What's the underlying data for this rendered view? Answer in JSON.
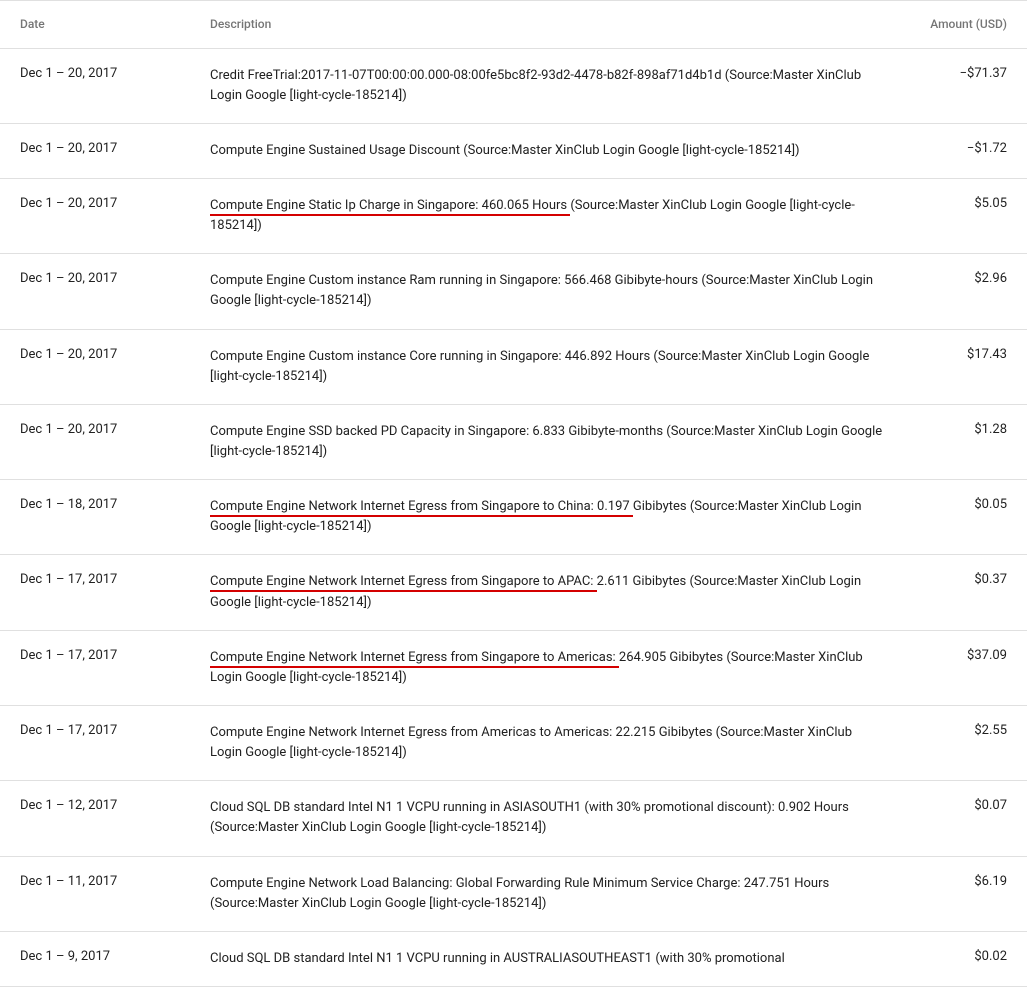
{
  "headers": {
    "date": "Date",
    "description": "Description",
    "amount": "Amount (USD)"
  },
  "rows": [
    {
      "date": "Dec 1 – 20, 2017",
      "desc_pre": "",
      "desc_hl": "",
      "desc_post": "Credit FreeTrial:2017-11-07T00:00:00.000-08:00fe5bc8f2-93d2-4478-b82f-898af71d4b1d (Source:Master XinClub Login Google [light-cycle-185214])",
      "amount": "−$71.37"
    },
    {
      "date": "Dec 1 – 20, 2017",
      "desc_pre": "",
      "desc_hl": "",
      "desc_post": "Compute Engine Sustained Usage Discount (Source:Master XinClub Login Google [light-cycle-185214])",
      "amount": "−$1.72"
    },
    {
      "date": "Dec 1 – 20, 2017",
      "desc_pre": "",
      "desc_hl": "Compute Engine Static Ip Charge in Singapore: 460.065 Hours ",
      "desc_post": "(Source:Master XinClub Login Google [light-cycle-185214])",
      "amount": "$5.05"
    },
    {
      "date": "Dec 1 – 20, 2017",
      "desc_pre": "",
      "desc_hl": "",
      "desc_post": "Compute Engine Custom instance Ram running in Singapore: 566.468 Gibibyte-hours (Source:Master XinClub Login Google [light-cycle-185214])",
      "amount": "$2.96"
    },
    {
      "date": "Dec 1 – 20, 2017",
      "desc_pre": "",
      "desc_hl": "",
      "desc_post": "Compute Engine Custom instance Core running in Singapore: 446.892 Hours (Source:Master XinClub Login Google [light-cycle-185214])",
      "amount": "$17.43"
    },
    {
      "date": "Dec 1 – 20, 2017",
      "desc_pre": "",
      "desc_hl": "",
      "desc_post": "Compute Engine SSD backed PD Capacity in Singapore: 6.833 Gibibyte-months (Source:Master XinClub Login Google [light-cycle-185214])",
      "amount": "$1.28"
    },
    {
      "date": "Dec 1 – 18, 2017",
      "desc_pre": "",
      "desc_hl": "Compute Engine Network Internet Egress from Singapore to China: 0.197 ",
      "desc_post": "Gibibytes (Source:Master XinClub Login Google [light-cycle-185214])",
      "amount": "$0.05"
    },
    {
      "date": "Dec 1 – 17, 2017",
      "desc_pre": "",
      "desc_hl": "Compute Engine Network Internet Egress from Singapore to APAC: ",
      "desc_post": "2.611 Gibibytes (Source:Master XinClub Login Google [light-cycle-185214])",
      "amount": "$0.37"
    },
    {
      "date": "Dec 1 – 17, 2017",
      "desc_pre": "",
      "desc_hl": "Compute Engine Network Internet Egress from Singapore to Americas: ",
      "desc_post": "264.905 Gibibytes (Source:Master XinClub Login Google [light-cycle-185214])",
      "amount": "$37.09"
    },
    {
      "date": "Dec 1 – 17, 2017",
      "desc_pre": "",
      "desc_hl": "",
      "desc_post": "Compute Engine Network Internet Egress from Americas to Americas: 22.215 Gibibytes (Source:Master XinClub Login Google [light-cycle-185214])",
      "amount": "$2.55"
    },
    {
      "date": "Dec 1 – 12, 2017",
      "desc_pre": "",
      "desc_hl": "",
      "desc_post": "Cloud SQL DB standard Intel N1 1 VCPU running in ASIASOUTH1 (with 30% promotional discount): 0.902 Hours (Source:Master XinClub Login Google [light-cycle-185214])",
      "amount": "$0.07"
    },
    {
      "date": "Dec 1 – 11, 2017",
      "desc_pre": "",
      "desc_hl": "",
      "desc_post": "Compute Engine Network Load Balancing: Global Forwarding Rule Minimum Service Charge: 247.751 Hours (Source:Master XinClub Login Google [light-cycle-185214])",
      "amount": "$6.19"
    },
    {
      "date": "Dec 1 – 9, 2017",
      "desc_pre": "",
      "desc_hl": "",
      "desc_post": "Cloud SQL DB standard Intel N1 1 VCPU running in AUSTRALIASOUTHEAST1 (with 30% promotional",
      "amount": "$0.02"
    }
  ]
}
